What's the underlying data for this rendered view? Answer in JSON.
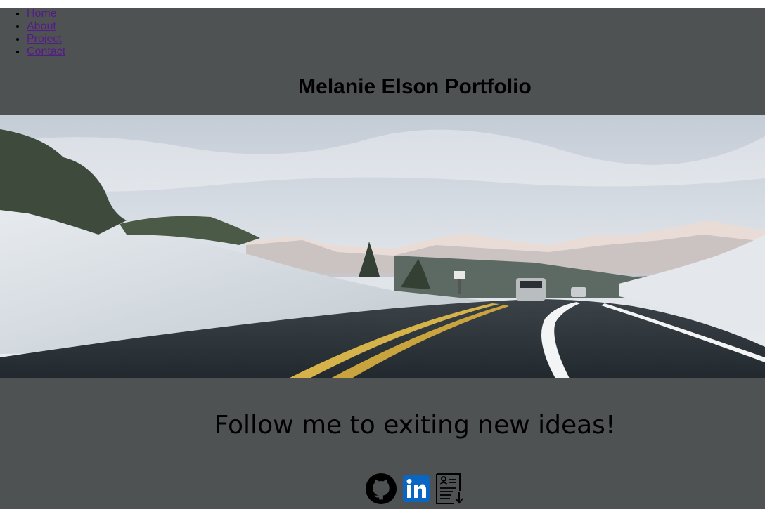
{
  "nav": {
    "items": [
      {
        "label": "Home"
      },
      {
        "label": "About"
      },
      {
        "label": "Project"
      },
      {
        "label": "Contact"
      }
    ]
  },
  "header": {
    "title": "Melanie Elson Portfolio"
  },
  "main": {
    "tagline": "Follow me to exiting new ideas!"
  },
  "social": {
    "icons": [
      "github-icon",
      "linkedin-icon",
      "resume-icon"
    ],
    "linkedin_color": "#0a66c2"
  },
  "colors": {
    "page_background": "#4f5252",
    "link": "#551a8b"
  }
}
